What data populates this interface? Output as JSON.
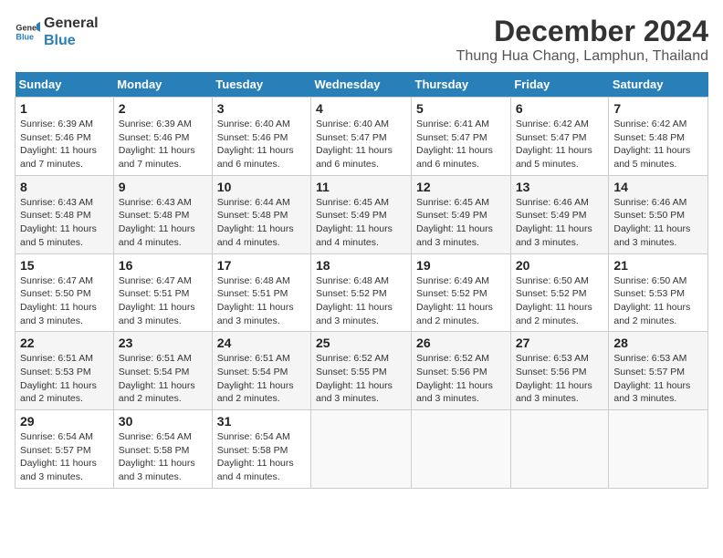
{
  "header": {
    "logo_line1": "General",
    "logo_line2": "Blue",
    "month": "December 2024",
    "location": "Thung Hua Chang, Lamphun, Thailand"
  },
  "weekdays": [
    "Sunday",
    "Monday",
    "Tuesday",
    "Wednesday",
    "Thursday",
    "Friday",
    "Saturday"
  ],
  "weeks": [
    [
      {
        "day": "1",
        "sunrise": "Sunrise: 6:39 AM",
        "sunset": "Sunset: 5:46 PM",
        "daylight": "Daylight: 11 hours and 7 minutes."
      },
      {
        "day": "2",
        "sunrise": "Sunrise: 6:39 AM",
        "sunset": "Sunset: 5:46 PM",
        "daylight": "Daylight: 11 hours and 7 minutes."
      },
      {
        "day": "3",
        "sunrise": "Sunrise: 6:40 AM",
        "sunset": "Sunset: 5:46 PM",
        "daylight": "Daylight: 11 hours and 6 minutes."
      },
      {
        "day": "4",
        "sunrise": "Sunrise: 6:40 AM",
        "sunset": "Sunset: 5:47 PM",
        "daylight": "Daylight: 11 hours and 6 minutes."
      },
      {
        "day": "5",
        "sunrise": "Sunrise: 6:41 AM",
        "sunset": "Sunset: 5:47 PM",
        "daylight": "Daylight: 11 hours and 6 minutes."
      },
      {
        "day": "6",
        "sunrise": "Sunrise: 6:42 AM",
        "sunset": "Sunset: 5:47 PM",
        "daylight": "Daylight: 11 hours and 5 minutes."
      },
      {
        "day": "7",
        "sunrise": "Sunrise: 6:42 AM",
        "sunset": "Sunset: 5:48 PM",
        "daylight": "Daylight: 11 hours and 5 minutes."
      }
    ],
    [
      {
        "day": "8",
        "sunrise": "Sunrise: 6:43 AM",
        "sunset": "Sunset: 5:48 PM",
        "daylight": "Daylight: 11 hours and 5 minutes."
      },
      {
        "day": "9",
        "sunrise": "Sunrise: 6:43 AM",
        "sunset": "Sunset: 5:48 PM",
        "daylight": "Daylight: 11 hours and 4 minutes."
      },
      {
        "day": "10",
        "sunrise": "Sunrise: 6:44 AM",
        "sunset": "Sunset: 5:48 PM",
        "daylight": "Daylight: 11 hours and 4 minutes."
      },
      {
        "day": "11",
        "sunrise": "Sunrise: 6:45 AM",
        "sunset": "Sunset: 5:49 PM",
        "daylight": "Daylight: 11 hours and 4 minutes."
      },
      {
        "day": "12",
        "sunrise": "Sunrise: 6:45 AM",
        "sunset": "Sunset: 5:49 PM",
        "daylight": "Daylight: 11 hours and 3 minutes."
      },
      {
        "day": "13",
        "sunrise": "Sunrise: 6:46 AM",
        "sunset": "Sunset: 5:49 PM",
        "daylight": "Daylight: 11 hours and 3 minutes."
      },
      {
        "day": "14",
        "sunrise": "Sunrise: 6:46 AM",
        "sunset": "Sunset: 5:50 PM",
        "daylight": "Daylight: 11 hours and 3 minutes."
      }
    ],
    [
      {
        "day": "15",
        "sunrise": "Sunrise: 6:47 AM",
        "sunset": "Sunset: 5:50 PM",
        "daylight": "Daylight: 11 hours and 3 minutes."
      },
      {
        "day": "16",
        "sunrise": "Sunrise: 6:47 AM",
        "sunset": "Sunset: 5:51 PM",
        "daylight": "Daylight: 11 hours and 3 minutes."
      },
      {
        "day": "17",
        "sunrise": "Sunrise: 6:48 AM",
        "sunset": "Sunset: 5:51 PM",
        "daylight": "Daylight: 11 hours and 3 minutes."
      },
      {
        "day": "18",
        "sunrise": "Sunrise: 6:48 AM",
        "sunset": "Sunset: 5:52 PM",
        "daylight": "Daylight: 11 hours and 3 minutes."
      },
      {
        "day": "19",
        "sunrise": "Sunrise: 6:49 AM",
        "sunset": "Sunset: 5:52 PM",
        "daylight": "Daylight: 11 hours and 2 minutes."
      },
      {
        "day": "20",
        "sunrise": "Sunrise: 6:50 AM",
        "sunset": "Sunset: 5:52 PM",
        "daylight": "Daylight: 11 hours and 2 minutes."
      },
      {
        "day": "21",
        "sunrise": "Sunrise: 6:50 AM",
        "sunset": "Sunset: 5:53 PM",
        "daylight": "Daylight: 11 hours and 2 minutes."
      }
    ],
    [
      {
        "day": "22",
        "sunrise": "Sunrise: 6:51 AM",
        "sunset": "Sunset: 5:53 PM",
        "daylight": "Daylight: 11 hours and 2 minutes."
      },
      {
        "day": "23",
        "sunrise": "Sunrise: 6:51 AM",
        "sunset": "Sunset: 5:54 PM",
        "daylight": "Daylight: 11 hours and 2 minutes."
      },
      {
        "day": "24",
        "sunrise": "Sunrise: 6:51 AM",
        "sunset": "Sunset: 5:54 PM",
        "daylight": "Daylight: 11 hours and 2 minutes."
      },
      {
        "day": "25",
        "sunrise": "Sunrise: 6:52 AM",
        "sunset": "Sunset: 5:55 PM",
        "daylight": "Daylight: 11 hours and 3 minutes."
      },
      {
        "day": "26",
        "sunrise": "Sunrise: 6:52 AM",
        "sunset": "Sunset: 5:56 PM",
        "daylight": "Daylight: 11 hours and 3 minutes."
      },
      {
        "day": "27",
        "sunrise": "Sunrise: 6:53 AM",
        "sunset": "Sunset: 5:56 PM",
        "daylight": "Daylight: 11 hours and 3 minutes."
      },
      {
        "day": "28",
        "sunrise": "Sunrise: 6:53 AM",
        "sunset": "Sunset: 5:57 PM",
        "daylight": "Daylight: 11 hours and 3 minutes."
      }
    ],
    [
      {
        "day": "29",
        "sunrise": "Sunrise: 6:54 AM",
        "sunset": "Sunset: 5:57 PM",
        "daylight": "Daylight: 11 hours and 3 minutes."
      },
      {
        "day": "30",
        "sunrise": "Sunrise: 6:54 AM",
        "sunset": "Sunset: 5:58 PM",
        "daylight": "Daylight: 11 hours and 3 minutes."
      },
      {
        "day": "31",
        "sunrise": "Sunrise: 6:54 AM",
        "sunset": "Sunset: 5:58 PM",
        "daylight": "Daylight: 11 hours and 4 minutes."
      },
      null,
      null,
      null,
      null
    ]
  ]
}
